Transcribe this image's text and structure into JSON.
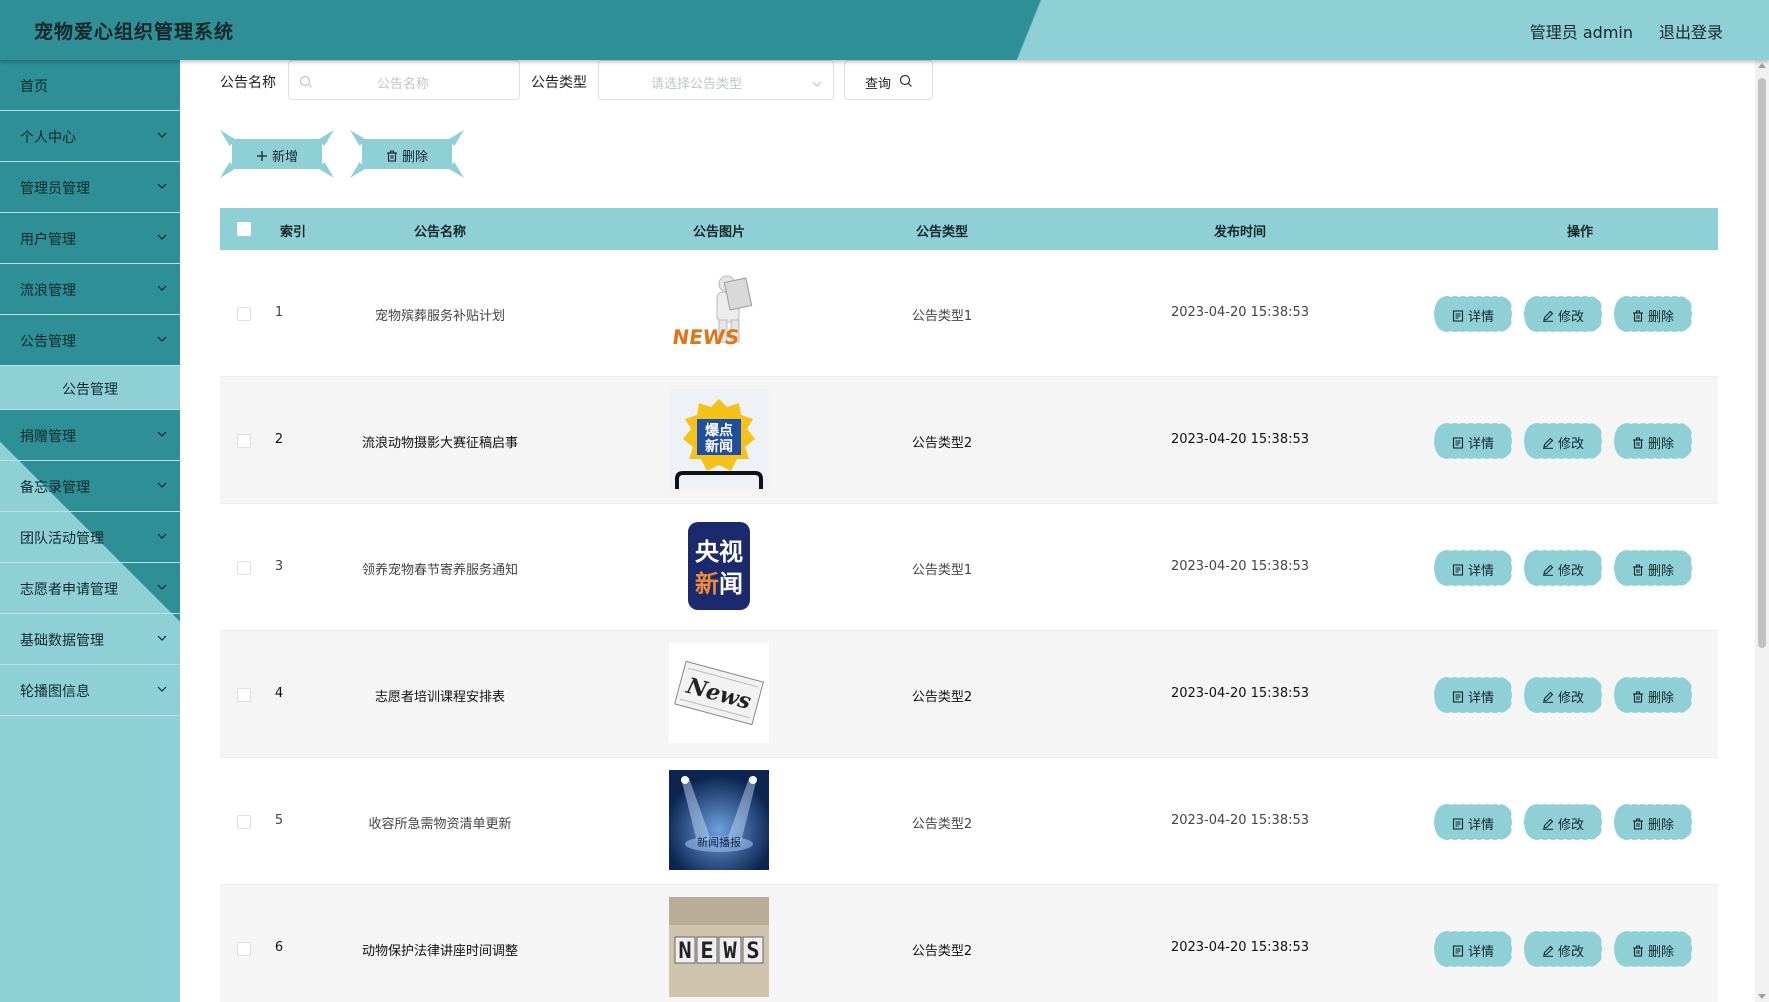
{
  "header": {
    "title": "宠物爱心组织管理系统",
    "user_label": "管理员 admin",
    "logout_label": "退出登录"
  },
  "sidebar": {
    "items": [
      {
        "label": "首页",
        "has_children": false
      },
      {
        "label": "个人中心",
        "has_children": true
      },
      {
        "label": "管理员管理",
        "has_children": true
      },
      {
        "label": "用户管理",
        "has_children": true
      },
      {
        "label": "流浪管理",
        "has_children": true
      },
      {
        "label": "公告管理",
        "has_children": true,
        "expanded": true
      },
      {
        "label": "捐赠管理",
        "has_children": true
      },
      {
        "label": "备忘录管理",
        "has_children": true
      },
      {
        "label": "团队活动管理",
        "has_children": true
      },
      {
        "label": "志愿者申请管理",
        "has_children": true
      },
      {
        "label": "基础数据管理",
        "has_children": true
      },
      {
        "label": "轮播图信息",
        "has_children": true
      }
    ],
    "active_sub": "公告管理"
  },
  "search": {
    "name_label": "公告名称",
    "name_placeholder": "公告名称",
    "type_label": "公告类型",
    "type_placeholder": "请选择公告类型",
    "query_label": "查询"
  },
  "actions": {
    "add_label": "新增",
    "delete_label": "删除"
  },
  "table": {
    "columns": [
      "索引",
      "公告名称",
      "公告图片",
      "公告类型",
      "发布时间",
      "操作"
    ],
    "row_actions": [
      "详情",
      "修改",
      "删除"
    ],
    "rows": [
      {
        "index": "1",
        "name": "宠物殡葬服务补贴计划",
        "image": "news-figure-image",
        "type": "公告类型1",
        "time": "2023-04-20 15:38:53"
      },
      {
        "index": "2",
        "name": "流浪动物摄影大赛征稿启事",
        "image": "breaking-news-image",
        "image_text": "爆点新闻",
        "type": "公告类型2",
        "time": "2023-04-20 15:38:53"
      },
      {
        "index": "3",
        "name": "领养宠物春节寄养服务通知",
        "image": "cctv-news-image",
        "image_text_top": "央视",
        "image_text_bottom": "新闻",
        "type": "公告类型1",
        "time": "2023-04-20 15:38:53"
      },
      {
        "index": "4",
        "name": "志愿者培训课程安排表",
        "image": "newspaper-image",
        "image_text": "News",
        "type": "公告类型2",
        "time": "2023-04-20 15:38:53"
      },
      {
        "index": "5",
        "name": "收容所急需物资清单更新",
        "image": "spotlight-stage-image",
        "image_text": "新闻播报",
        "type": "公告类型2",
        "time": "2023-04-20 15:38:53"
      },
      {
        "index": "6",
        "name": "动物保护法律讲座时间调整",
        "image": "news-blocks-image",
        "image_text": "NEWS",
        "type": "公告类型2",
        "time": "2023-04-20 15:38:53"
      }
    ]
  },
  "colors": {
    "primary": "#2e8f97",
    "accent": "#8fd0d6",
    "row_alt": "#f5f5f5"
  }
}
